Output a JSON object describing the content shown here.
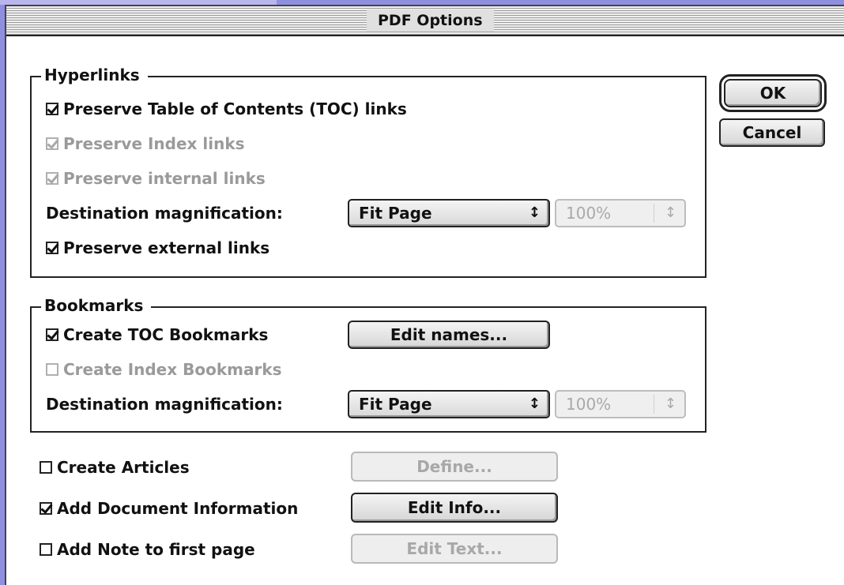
{
  "dialog": {
    "title": "PDF Options",
    "ok_label": "OK",
    "cancel_label": "Cancel"
  },
  "hyperlinks": {
    "legend": "Hyperlinks",
    "preserve_toc": {
      "label": "Preserve Table of Contents (TOC) links",
      "checked": true,
      "enabled": true
    },
    "preserve_index": {
      "label": "Preserve Index links",
      "checked": true,
      "enabled": false
    },
    "preserve_internal": {
      "label": "Preserve internal links",
      "checked": true,
      "enabled": false
    },
    "dest_mag_label": "Destination magnification:",
    "dest_mag_value": "Fit Page",
    "percent_value": "100%",
    "preserve_external": {
      "label": "Preserve external links",
      "checked": true,
      "enabled": true
    }
  },
  "bookmarks": {
    "legend": "Bookmarks",
    "create_toc": {
      "label": "Create TOC Bookmarks",
      "checked": true,
      "enabled": true
    },
    "edit_names_label": "Edit names...",
    "create_index": {
      "label": "Create Index Bookmarks",
      "checked": false,
      "enabled": false
    },
    "dest_mag_label": "Destination magnification:",
    "dest_mag_value": "Fit Page",
    "percent_value": "100%"
  },
  "options": {
    "create_articles": {
      "label": "Create Articles",
      "checked": false,
      "button_label": "Define...",
      "button_enabled": false
    },
    "add_doc_info": {
      "label": "Add Document Information",
      "checked": true,
      "button_label": "Edit Info...",
      "button_enabled": true
    },
    "add_note": {
      "label": "Add Note to first page",
      "checked": false,
      "button_label": "Edit Text...",
      "button_enabled": false
    }
  },
  "icons": {
    "popup_arrows": "up-down-arrows-icon",
    "checkbox": "checkmark-icon"
  },
  "colors": {
    "desktop": "#8f8fe0",
    "window_bg": "#ffffff",
    "disabled_text": "#9a9a9a"
  }
}
